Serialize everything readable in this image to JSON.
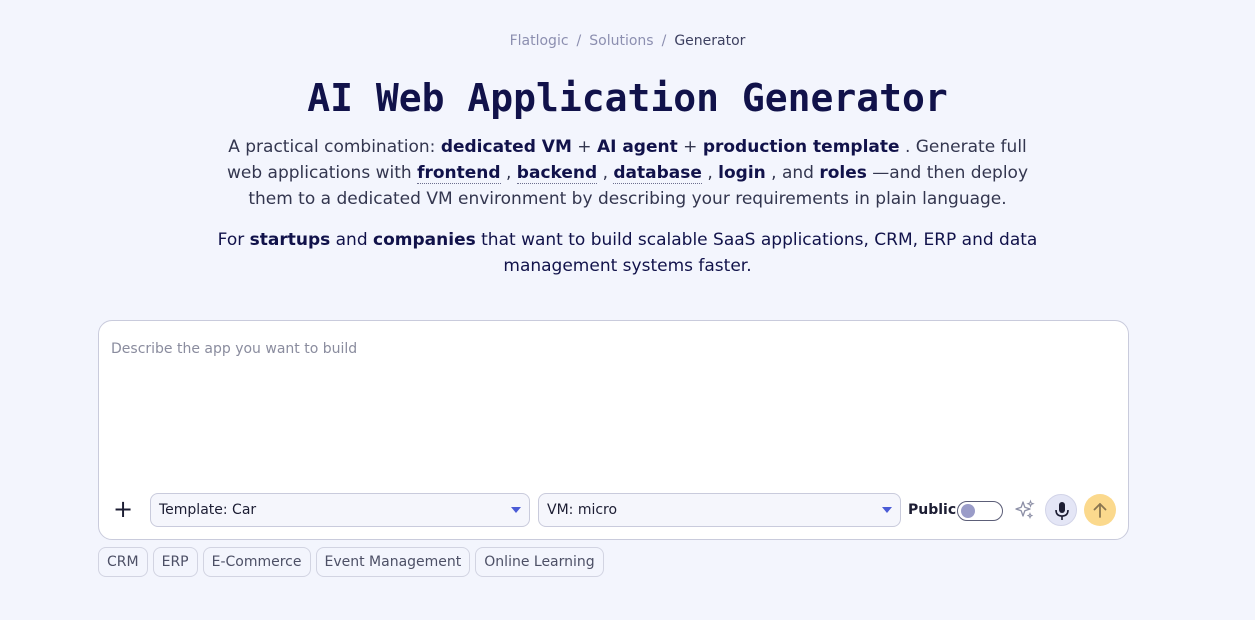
{
  "breadcrumb": {
    "items": [
      "Flatlogic",
      "Solutions"
    ],
    "current": "Generator",
    "separator": "/"
  },
  "header": {
    "title": "AI Web Application Generator"
  },
  "intro": {
    "p1_a": "A practical combination: ",
    "p1_b1": "dedicated VM",
    "p1_plus1": " + ",
    "p1_b2": "AI agent",
    "p1_plus2": " + ",
    "p1_b3": "production template",
    "p1_c": " . Generate full web applications with ",
    "link_frontend": "frontend",
    "comma1": " , ",
    "link_backend": "backend",
    "comma2": " , ",
    "link_database": "database",
    "comma3": " , ",
    "b_login": "login",
    "and": " , and ",
    "b_roles": "roles",
    "p1_d": " —and then deploy them to a dedicated VM environment by describing your requirements in plain language."
  },
  "tagline": {
    "a": "For ",
    "b1": "startups",
    "c": " and ",
    "b2": "companies",
    "d": " that want to build scalable SaaS applications, CRM, ERP and data management systems faster."
  },
  "prompt": {
    "placeholder": "Describe the app you want to build",
    "value": "",
    "add_icon": "plus-icon",
    "template_select": "Template: Car",
    "vm_select": "VM: micro",
    "public_label": "Public",
    "public_enabled": false
  },
  "chips": [
    "CRM",
    "ERP",
    "E-Commerce",
    "Event Management",
    "Online Learning"
  ],
  "colors": {
    "background": "#f3f5fd",
    "title": "#11124a",
    "accent": "#4a5bd6",
    "send": "#fbd98d"
  }
}
